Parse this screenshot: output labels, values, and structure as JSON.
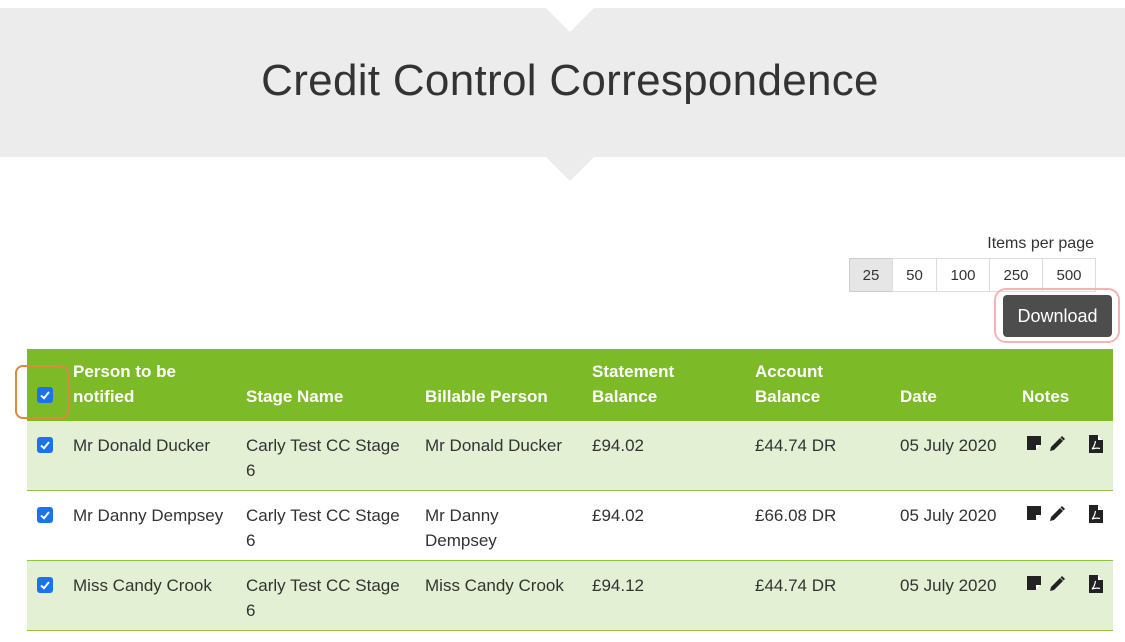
{
  "header": {
    "title": "Credit Control Correspondence"
  },
  "pagination": {
    "label": "Items per page",
    "options": [
      "25",
      "50",
      "100",
      "250",
      "500"
    ],
    "selected": "25"
  },
  "download": {
    "label": "Download"
  },
  "table": {
    "columns": {
      "person_line1": "Person to be",
      "person_line2": "notified",
      "stage": "Stage Name",
      "billable": "Billable Person",
      "statement_line1": "Statement",
      "statement_line2": "Balance",
      "account_line1": "Account",
      "account_line2": "Balance",
      "date": "Date",
      "notes": "Notes"
    },
    "header_checked": true,
    "rows": [
      {
        "checked": true,
        "person": "Mr Donald Ducker",
        "stage_line1": "Carly Test CC Stage",
        "stage_line2": "6",
        "billable_line1": "Mr Donald Ducker",
        "billable_line2": "",
        "statement": "£94.02",
        "account": "£44.74 DR",
        "date": "05 July 2020"
      },
      {
        "checked": true,
        "person": "Mr Danny Dempsey",
        "stage_line1": "Carly Test CC Stage",
        "stage_line2": "6",
        "billable_line1": "Mr Danny",
        "billable_line2": "Dempsey",
        "statement": "£94.02",
        "account": "£66.08 DR",
        "date": "05 July 2020"
      },
      {
        "checked": true,
        "person": "Miss Candy Crook",
        "stage_line1": "Carly Test CC Stage",
        "stage_line2": "6",
        "billable_line1": "Miss Candy Crook",
        "billable_line2": "",
        "statement": "£94.12",
        "account": "£44.74 DR",
        "date": "05 July 2020"
      }
    ]
  },
  "colors": {
    "header_green": "#7cba27",
    "row_alt": "#e3f0d3",
    "checkbox_blue": "#1a73e8",
    "download_bg": "#4d4d4d"
  },
  "icons": [
    "note-icon",
    "pencil-icon",
    "pdf-icon"
  ]
}
